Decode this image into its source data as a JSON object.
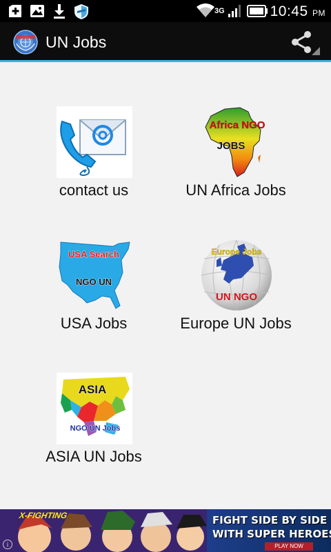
{
  "status_bar": {
    "time": "10:45",
    "ampm": "PM",
    "network": "3G",
    "icons": [
      "add-box-icon",
      "image-icon",
      "download-icon",
      "shield-icon",
      "wifi-icon",
      "signal-icon",
      "battery-icon"
    ]
  },
  "action_bar": {
    "title": "UN Jobs",
    "share_icon": "share-icon"
  },
  "grid": {
    "items": [
      {
        "label": "contact us"
      },
      {
        "label": "UN Africa Jobs",
        "image_text": [
          "Africa NGO",
          "JOBS"
        ]
      },
      {
        "label": "USA Jobs",
        "image_text": [
          "USA Search",
          "NGO UN"
        ]
      },
      {
        "label": "Europe UN Jobs",
        "image_text": [
          "Europe Jobs",
          "UN NGO"
        ]
      },
      {
        "label": "ASIA UN Jobs",
        "image_text": [
          "ASIA",
          "NGO UN Jobs"
        ]
      }
    ]
  },
  "ad": {
    "brand": "X-FIGHTING",
    "line1": "FIGHT SIDE BY SIDE",
    "line2": "WITH SUPER HEROES",
    "cta": "PLAY NOW",
    "info": "i"
  },
  "colors": {
    "accent": "#33b5e5",
    "background": "#f2f2f2",
    "action_bar": "#0d0d0d"
  }
}
